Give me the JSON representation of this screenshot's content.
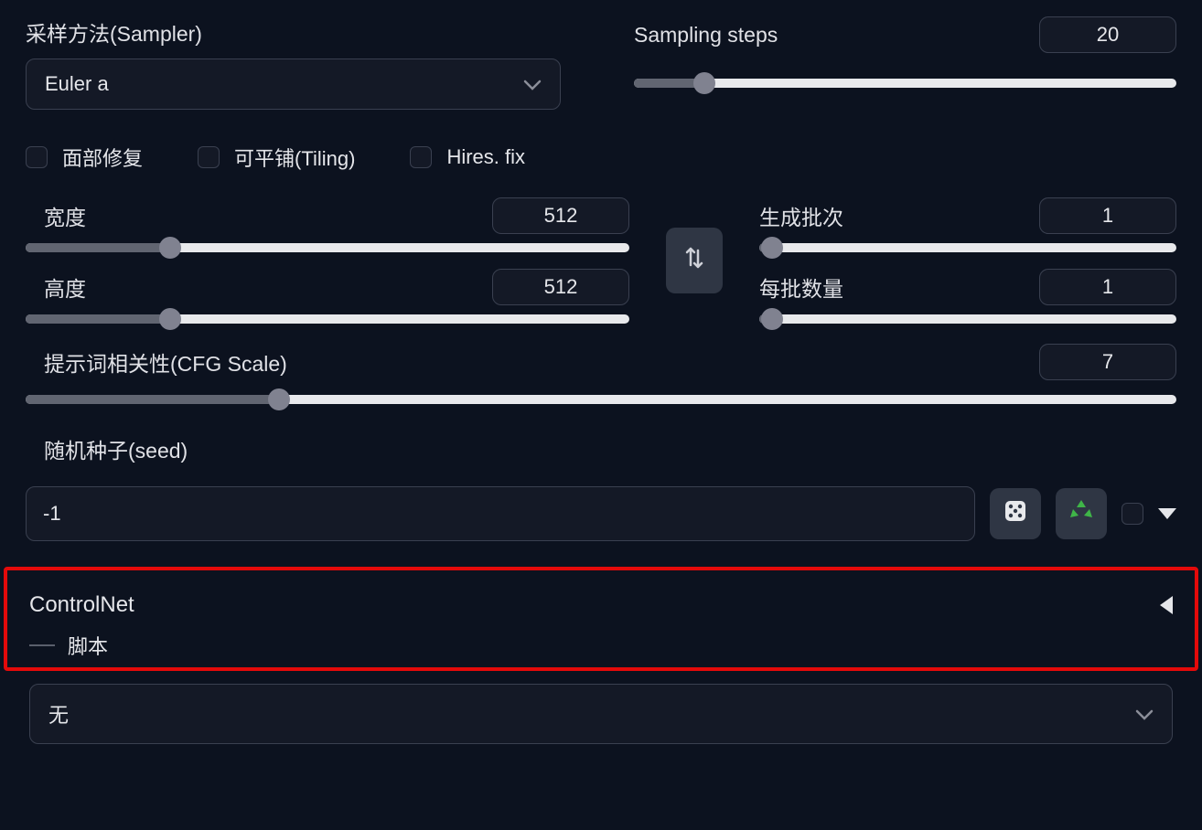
{
  "sampler": {
    "label": "采样方法(Sampler)",
    "value": "Euler a"
  },
  "steps": {
    "label": "Sampling steps",
    "value": "20",
    "fill_pct": 13
  },
  "checkboxes": {
    "face": "面部修复",
    "tiling": "可平铺(Tiling)",
    "hires": "Hires. fix"
  },
  "width": {
    "label": "宽度",
    "value": "512",
    "fill_pct": 24
  },
  "height": {
    "label": "高度",
    "value": "512",
    "fill_pct": 24
  },
  "batch_count": {
    "label": "生成批次",
    "value": "1",
    "fill_pct": 3
  },
  "batch_size": {
    "label": "每批数量",
    "value": "1",
    "fill_pct": 3
  },
  "cfg": {
    "label": "提示词相关性(CFG Scale)",
    "value": "7",
    "fill_pct": 22
  },
  "seed": {
    "label": "随机种子(seed)",
    "value": "-1"
  },
  "controlnet": {
    "title": "ControlNet"
  },
  "script": {
    "label": "脚本",
    "value": "无"
  }
}
